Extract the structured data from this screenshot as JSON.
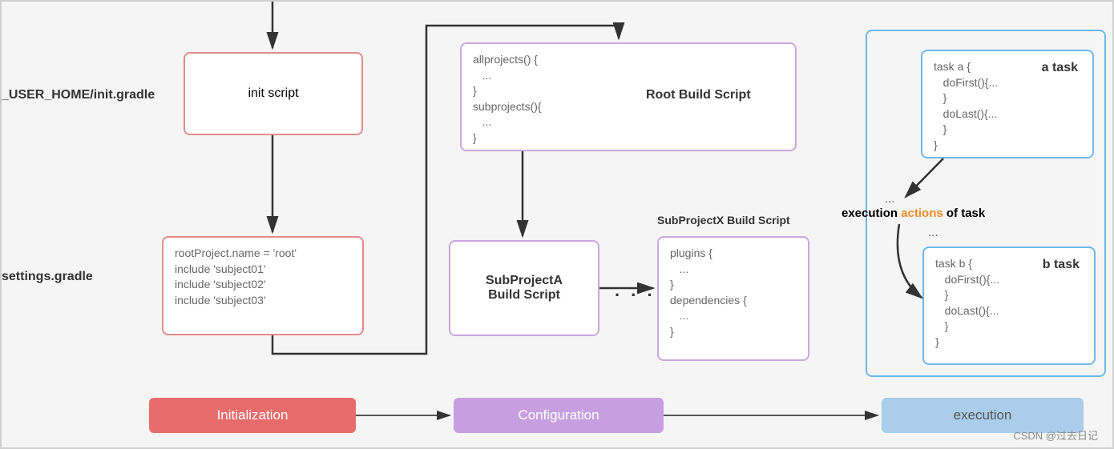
{
  "sideLabels": {
    "initGradle": "_USER_HOME/init.gradle",
    "settings": "settings.gradle"
  },
  "boxes": {
    "initScript": "init script",
    "settingsCode": "rootProject.name = 'root'\ninclude 'subject01'\ninclude 'subject02'\ninclude 'subject03'",
    "rootBuildLabel": "Root Build Script",
    "rootBuildCode": "allprojects() {\n   ...\n}\nsubprojects(){\n   ...\n}",
    "subALabel": "SubProjectA\nBuild Script",
    "subXLabel": "SubProjectX Build Script",
    "subXCode": "plugins {\n   ...\n}\ndependencies {\n   ...\n}",
    "taskALabel": "a task",
    "taskACode": "task a {\n   doFirst(){...\n   }\n   doLast(){...\n   }\n}",
    "taskBLabel": "b task",
    "taskBCode": "task b {\n   doFirst(){...\n   }\n   doLast(){...\n   }\n}",
    "execMidPre": "...",
    "execMidText": "execution actions of task",
    "execMidPost": "..."
  },
  "phases": {
    "init": "Initialization",
    "config": "Configuration",
    "exec": "execution"
  },
  "dots": ". . .",
  "watermark": "CSDN @过去日记"
}
